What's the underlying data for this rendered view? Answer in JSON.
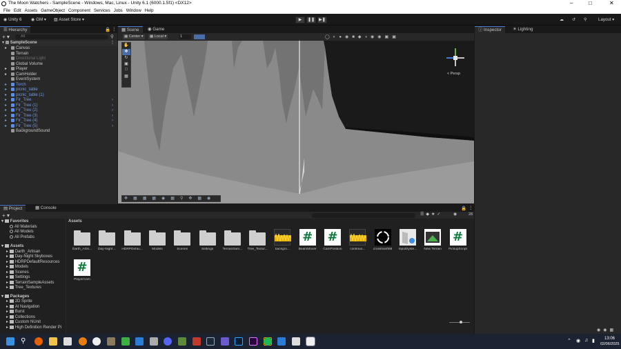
{
  "window": {
    "title": "The Moon Watchers - SampleScene - Windows, Mac, Linux - Unity 6.1 (6000.1.5f1) <DX12>"
  },
  "menu": [
    "File",
    "Edit",
    "Assets",
    "GameObject",
    "Component",
    "Services",
    "Jobs",
    "Window",
    "Help"
  ],
  "toolbar": {
    "account": "Unity 6",
    "user": "GM",
    "store": "Asset Store",
    "layout": "Layout"
  },
  "hierarchy": {
    "tab": "Hierarchy",
    "search_placeholder": "All",
    "scene": "SampleScene",
    "items": [
      {
        "label": "Canvas",
        "type": "normal"
      },
      {
        "label": "Terrain",
        "type": "normal"
      },
      {
        "label": "Directional Light",
        "type": "dim"
      },
      {
        "label": "Global Volume",
        "type": "normal"
      },
      {
        "label": "Player",
        "type": "normal"
      },
      {
        "label": "CamHolder",
        "type": "normal"
      },
      {
        "label": "EventSystem",
        "type": "normal"
      },
      {
        "label": "Torch",
        "type": "prefab"
      },
      {
        "label": "picnic_table",
        "type": "prefab"
      },
      {
        "label": "picnic_table (1)",
        "type": "prefab"
      },
      {
        "label": "Fir_Tree",
        "type": "prefab"
      },
      {
        "label": "Fir_Tree (1)",
        "type": "prefab"
      },
      {
        "label": "Fir_Tree (2)",
        "type": "prefab"
      },
      {
        "label": "Fir_Tree (3)",
        "type": "prefab"
      },
      {
        "label": "Fir_Tree (4)",
        "type": "prefab"
      },
      {
        "label": "Fir_Tree (5)",
        "type": "prefab"
      },
      {
        "label": "BackgroundSound",
        "type": "normal"
      }
    ]
  },
  "scene": {
    "tabs": [
      "Scene",
      "Game"
    ],
    "pivot": "Center",
    "space": "Local",
    "snap": "1",
    "persp": "< Persp"
  },
  "inspector": {
    "tabs": [
      "Inspector",
      "Lighting"
    ]
  },
  "project": {
    "tabs": [
      "Project",
      "Console"
    ],
    "breadcrumb": "Assets",
    "count": "28",
    "favorites": {
      "label": "Favorites",
      "items": [
        "All Materials",
        "All Models",
        "All Prefabs"
      ]
    },
    "assets_tree": {
      "label": "Assets",
      "items": [
        "Darth_Artisan",
        "Day-Night Skyboxes",
        "HDRPDefaultResources",
        "Models",
        "Scenes",
        "Settings",
        "TerrainSampleAssets",
        "Tree_Textures"
      ]
    },
    "packages": {
      "label": "Packages",
      "items": [
        "2D Sprite",
        "AI Navigation",
        "Burst",
        "Collections",
        "Custom NUnit",
        "High Definition Render Pi"
      ]
    },
    "assets": [
      {
        "label": "Darth_Artis...",
        "kind": "folder"
      },
      {
        "label": "Day-Night ...",
        "kind": "folder"
      },
      {
        "label": "HDRPDefau...",
        "kind": "folder"
      },
      {
        "label": "Models",
        "kind": "folder"
      },
      {
        "label": "Scenes",
        "kind": "folder"
      },
      {
        "label": "Settings",
        "kind": "folder"
      },
      {
        "label": "TerrainSam...",
        "kind": "folder"
      },
      {
        "label": "Tree_Textur...",
        "kind": "folder"
      },
      {
        "label": "backgro...",
        "kind": "audio"
      },
      {
        "label": "BeamMover",
        "kind": "script"
      },
      {
        "label": "CamPosition",
        "kind": "script"
      },
      {
        "label": "continuo...",
        "kind": "audio"
      },
      {
        "label": "crosshair068",
        "kind": "image"
      },
      {
        "label": "InputSyste...",
        "kind": "input"
      },
      {
        "label": "New Terrain",
        "kind": "terrain"
      },
      {
        "label": "PickupScript",
        "kind": "script"
      },
      {
        "label": "PlayerCam",
        "kind": "script"
      }
    ]
  },
  "taskbar": {
    "time": "13:06",
    "date": "02/06/2025"
  },
  "colors": {
    "accent": "#4a7bd6",
    "prefab": "#6f9bea",
    "script_green": "#0e7a3c",
    "audio_yellow": "#e8b400"
  }
}
